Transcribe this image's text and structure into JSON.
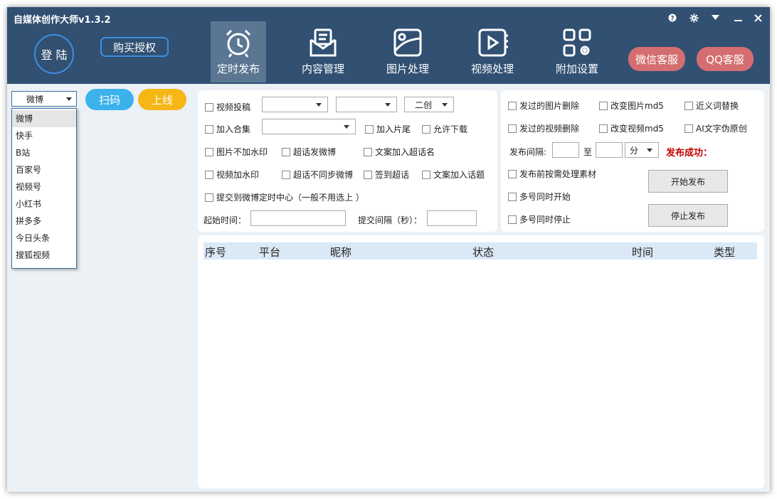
{
  "app": {
    "title": "自媒体创作大师v1.3.2"
  },
  "window_controls": {
    "help": "?",
    "settings": "✱",
    "menu": "▼",
    "minimize": "—",
    "close": "✕"
  },
  "header": {
    "login_label": "登 陆",
    "buy_label": "购买授权",
    "nav": [
      {
        "label": "定时发布",
        "icon": "alarm-clock-icon",
        "active": true
      },
      {
        "label": "内容管理",
        "icon": "mail-envelope-icon",
        "active": false
      },
      {
        "label": "图片处理",
        "icon": "image-icon",
        "active": false
      },
      {
        "label": "视频处理",
        "icon": "video-play-icon",
        "active": false
      },
      {
        "label": "附加设置",
        "icon": "grid-settings-icon",
        "active": false
      }
    ],
    "wechat_service": "微信客服",
    "qq_service": "QQ客服"
  },
  "left": {
    "selected_platform": "微博",
    "platforms": [
      "微博",
      "快手",
      "B站",
      "百家号",
      "视频号",
      "小红书",
      "拼多多",
      "今日头条",
      "搜狐视频"
    ],
    "scan_label": "扫码",
    "online_label": "上线"
  },
  "settings": {
    "video_post": "视频投稿",
    "combo1": "",
    "combo2": "",
    "combo3": "二创",
    "add_collection": "加入合集",
    "collection_combo": "",
    "add_ending": "加入片尾",
    "allow_download": "允许下载",
    "image_no_watermark": "图片不加水印",
    "super_topic_post": "超话发微博",
    "add_super_topic_name": "文案加入超话名",
    "video_watermark": "视频加水印",
    "super_topic_no_sync": "超话不同步微博",
    "checkin_super_topic": "签到超话",
    "add_topic": "文案加入话题",
    "submit_weibo_center": "提交到微博定时中心（一般不用选上 ）",
    "start_time_label": "起始时间：",
    "start_time_value": "",
    "submit_interval_label": "提交间隔（秒）：",
    "submit_interval_value": ""
  },
  "publish": {
    "delete_posted_images": "发过的图片删除",
    "change_image_md5": "改变图片md5",
    "synonym_replace": "近义词替换",
    "delete_posted_videos": "发过的视频删除",
    "change_video_md5": "改变视频md5",
    "ai_pseudo_original": "AI文字伪原创",
    "interval_label": "发布间隔:",
    "interval_from": "",
    "to_label": "至",
    "interval_to": "",
    "unit": "分",
    "status": "发布成功：",
    "preprocess_material": "发布前按需处理素材",
    "multi_start": "多号同时开始",
    "multi_stop": "多号同时停止",
    "start_button": "开始发布",
    "stop_button": "停止发布"
  },
  "table": {
    "columns": [
      "序号",
      "平台",
      "昵称",
      "状态",
      "时间",
      "类型"
    ],
    "rows": []
  }
}
